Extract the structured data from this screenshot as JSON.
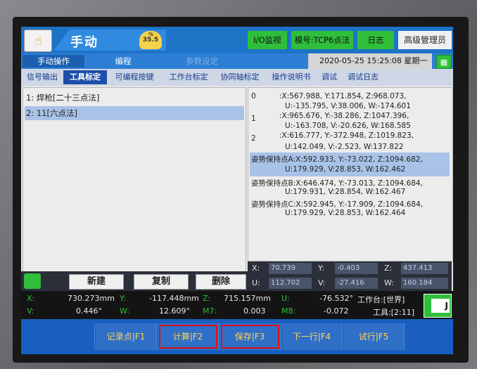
{
  "header": {
    "mode": "手动",
    "speed": "35.5",
    "speed_prefix": "%",
    "io_monitor": "I/O监视",
    "model": "模号:TCP6点法",
    "log": "日志",
    "user": "高级管理员"
  },
  "tabs_top": {
    "manual_op": "手动操作",
    "programming": "编程",
    "param_settings": "参数设定",
    "datetime": "2020-05-25  15:25:08  星期一"
  },
  "tabs_sub": [
    {
      "label": "信号输出"
    },
    {
      "label": "工具标定"
    },
    {
      "label": "可编程按键"
    },
    {
      "label": "工作台标定"
    },
    {
      "label": "协同轴标定"
    },
    {
      "label": "操作说明书"
    },
    {
      "label": "调试"
    },
    {
      "label": "调试日志"
    }
  ],
  "tool_list": [
    {
      "label": "1: 焊枪[二十三点法]"
    },
    {
      "label": "2: 11[六点法]"
    }
  ],
  "points": {
    "p0_idx": "0",
    "p0_l1": ":X:567.988, Y:171.854, Z:968.073, ",
    "p0_l2": "U:-135.795, V:38.006, W:-174.601",
    "p1_idx": "1",
    "p1_l1": ":X:965.676, Y:-38.286, Z:1047.396,",
    "p1_l2": "U:-163.708, V:-20.626, W:168.585",
    "p2_idx": "2",
    "p2_l1": ":X:616.777, Y:-372.948, Z:1019.823,",
    "p2_l2": "U:142.049, V:-2.523, W:137.822",
    "pA_l1": "姿势保持点A:X:592.933, Y:-73.022, Z:1094.682,",
    "pA_l2": "U:179.929, V:28.853, W:162.462",
    "pB_l1": "姿势保持点B:X:646.474, Y:-73.013, Z:1094.684,",
    "pB_l2": "U:179.931, V:28.854, W:162.467",
    "pC_l1": "姿势保持点C:X:592.945, Y:-17.909, Z:1094.684,",
    "pC_l2": "U:179.929, V:28.853, W:162.464"
  },
  "coords": {
    "x_label": "X:",
    "x": "70.739",
    "y_label": "Y:",
    "y": "-0.403",
    "z_label": "Z:",
    "z": "437.413",
    "u_label": "U:",
    "u": "112.702",
    "v_label": "V:",
    "v": "-27.416",
    "w_label": "W:",
    "w": "160.184"
  },
  "actions": {
    "new": "新建",
    "copy": "复制",
    "delete": "删除"
  },
  "status": {
    "x_lbl": "X:",
    "x_val": "730.273mm",
    "y_lbl": "Y:",
    "y_val": "-117.448mm",
    "z_lbl": "Z:",
    "z_val": "715.157mm",
    "u_lbl": "U:",
    "u_val": "-76.532°",
    "v_lbl": "V:",
    "v_val": "0.446°",
    "w_lbl": "W:",
    "w_val": "12.609°",
    "m7_lbl": "M7:",
    "m7_val": "0.003",
    "m8_lbl": "M8:",
    "m8_val": "-0.072",
    "workbench": "工作台:[世界]",
    "tool": "工具:[2:11]",
    "wj": "J"
  },
  "fkeys": [
    {
      "label": "记录点|F1"
    },
    {
      "label": "计算|F2"
    },
    {
      "label": "保存|F3"
    },
    {
      "label": "下一行|F4"
    },
    {
      "label": "试行|F5"
    }
  ],
  "colors": {
    "accent_blue": "#1d73c6",
    "green": "#2fbf3a",
    "highlight": "#e01010"
  }
}
